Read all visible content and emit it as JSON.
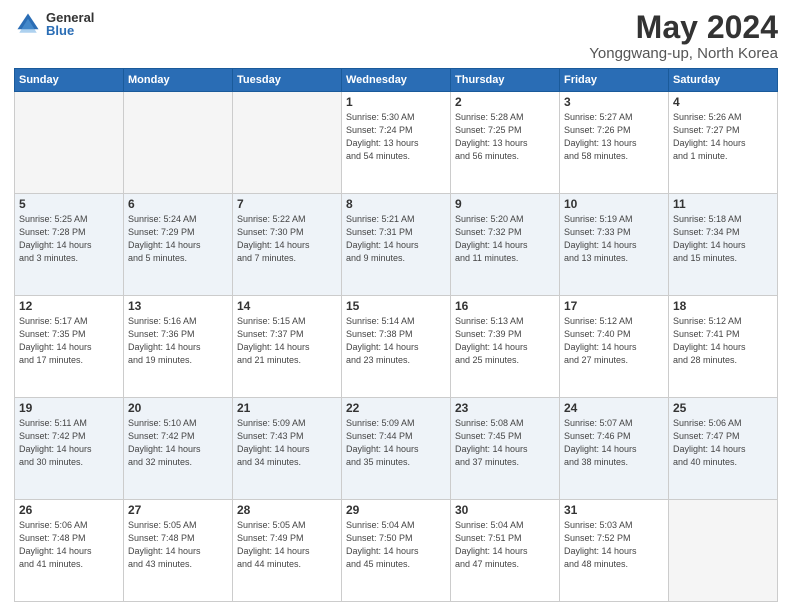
{
  "logo": {
    "general": "General",
    "blue": "Blue"
  },
  "title": {
    "month_year": "May 2024",
    "location": "Yonggwang-up, North Korea"
  },
  "weekdays": [
    "Sunday",
    "Monday",
    "Tuesday",
    "Wednesday",
    "Thursday",
    "Friday",
    "Saturday"
  ],
  "weeks": [
    [
      {
        "day": "",
        "info": ""
      },
      {
        "day": "",
        "info": ""
      },
      {
        "day": "",
        "info": ""
      },
      {
        "day": "1",
        "info": "Sunrise: 5:30 AM\nSunset: 7:24 PM\nDaylight: 13 hours\nand 54 minutes."
      },
      {
        "day": "2",
        "info": "Sunrise: 5:28 AM\nSunset: 7:25 PM\nDaylight: 13 hours\nand 56 minutes."
      },
      {
        "day": "3",
        "info": "Sunrise: 5:27 AM\nSunset: 7:26 PM\nDaylight: 13 hours\nand 58 minutes."
      },
      {
        "day": "4",
        "info": "Sunrise: 5:26 AM\nSunset: 7:27 PM\nDaylight: 14 hours\nand 1 minute."
      }
    ],
    [
      {
        "day": "5",
        "info": "Sunrise: 5:25 AM\nSunset: 7:28 PM\nDaylight: 14 hours\nand 3 minutes."
      },
      {
        "day": "6",
        "info": "Sunrise: 5:24 AM\nSunset: 7:29 PM\nDaylight: 14 hours\nand 5 minutes."
      },
      {
        "day": "7",
        "info": "Sunrise: 5:22 AM\nSunset: 7:30 PM\nDaylight: 14 hours\nand 7 minutes."
      },
      {
        "day": "8",
        "info": "Sunrise: 5:21 AM\nSunset: 7:31 PM\nDaylight: 14 hours\nand 9 minutes."
      },
      {
        "day": "9",
        "info": "Sunrise: 5:20 AM\nSunset: 7:32 PM\nDaylight: 14 hours\nand 11 minutes."
      },
      {
        "day": "10",
        "info": "Sunrise: 5:19 AM\nSunset: 7:33 PM\nDaylight: 14 hours\nand 13 minutes."
      },
      {
        "day": "11",
        "info": "Sunrise: 5:18 AM\nSunset: 7:34 PM\nDaylight: 14 hours\nand 15 minutes."
      }
    ],
    [
      {
        "day": "12",
        "info": "Sunrise: 5:17 AM\nSunset: 7:35 PM\nDaylight: 14 hours\nand 17 minutes."
      },
      {
        "day": "13",
        "info": "Sunrise: 5:16 AM\nSunset: 7:36 PM\nDaylight: 14 hours\nand 19 minutes."
      },
      {
        "day": "14",
        "info": "Sunrise: 5:15 AM\nSunset: 7:37 PM\nDaylight: 14 hours\nand 21 minutes."
      },
      {
        "day": "15",
        "info": "Sunrise: 5:14 AM\nSunset: 7:38 PM\nDaylight: 14 hours\nand 23 minutes."
      },
      {
        "day": "16",
        "info": "Sunrise: 5:13 AM\nSunset: 7:39 PM\nDaylight: 14 hours\nand 25 minutes."
      },
      {
        "day": "17",
        "info": "Sunrise: 5:12 AM\nSunset: 7:40 PM\nDaylight: 14 hours\nand 27 minutes."
      },
      {
        "day": "18",
        "info": "Sunrise: 5:12 AM\nSunset: 7:41 PM\nDaylight: 14 hours\nand 28 minutes."
      }
    ],
    [
      {
        "day": "19",
        "info": "Sunrise: 5:11 AM\nSunset: 7:42 PM\nDaylight: 14 hours\nand 30 minutes."
      },
      {
        "day": "20",
        "info": "Sunrise: 5:10 AM\nSunset: 7:42 PM\nDaylight: 14 hours\nand 32 minutes."
      },
      {
        "day": "21",
        "info": "Sunrise: 5:09 AM\nSunset: 7:43 PM\nDaylight: 14 hours\nand 34 minutes."
      },
      {
        "day": "22",
        "info": "Sunrise: 5:09 AM\nSunset: 7:44 PM\nDaylight: 14 hours\nand 35 minutes."
      },
      {
        "day": "23",
        "info": "Sunrise: 5:08 AM\nSunset: 7:45 PM\nDaylight: 14 hours\nand 37 minutes."
      },
      {
        "day": "24",
        "info": "Sunrise: 5:07 AM\nSunset: 7:46 PM\nDaylight: 14 hours\nand 38 minutes."
      },
      {
        "day": "25",
        "info": "Sunrise: 5:06 AM\nSunset: 7:47 PM\nDaylight: 14 hours\nand 40 minutes."
      }
    ],
    [
      {
        "day": "26",
        "info": "Sunrise: 5:06 AM\nSunset: 7:48 PM\nDaylight: 14 hours\nand 41 minutes."
      },
      {
        "day": "27",
        "info": "Sunrise: 5:05 AM\nSunset: 7:48 PM\nDaylight: 14 hours\nand 43 minutes."
      },
      {
        "day": "28",
        "info": "Sunrise: 5:05 AM\nSunset: 7:49 PM\nDaylight: 14 hours\nand 44 minutes."
      },
      {
        "day": "29",
        "info": "Sunrise: 5:04 AM\nSunset: 7:50 PM\nDaylight: 14 hours\nand 45 minutes."
      },
      {
        "day": "30",
        "info": "Sunrise: 5:04 AM\nSunset: 7:51 PM\nDaylight: 14 hours\nand 47 minutes."
      },
      {
        "day": "31",
        "info": "Sunrise: 5:03 AM\nSunset: 7:52 PM\nDaylight: 14 hours\nand 48 minutes."
      },
      {
        "day": "",
        "info": ""
      }
    ]
  ]
}
